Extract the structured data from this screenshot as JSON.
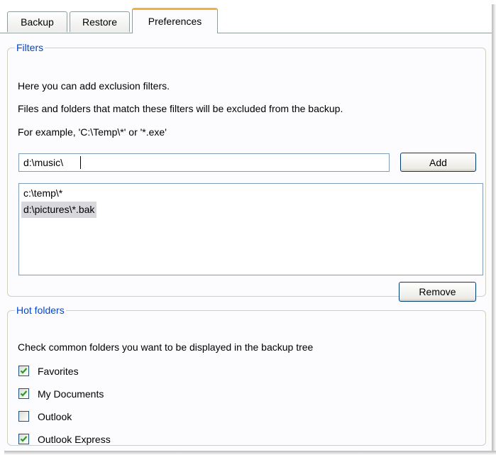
{
  "tabs": [
    {
      "label": "Backup",
      "active": false
    },
    {
      "label": "Restore",
      "active": false
    },
    {
      "label": "Preferences",
      "active": true
    }
  ],
  "filters": {
    "title": "Filters",
    "line1": "Here you can add exclusion filters.",
    "line2": "Files and folders that match these filters will be excluded from the backup.",
    "line3": "For example, 'C:\\Temp\\*' or '*.exe'",
    "input_value": "d:\\music\\",
    "add_label": "Add",
    "items": [
      {
        "text": "c:\\temp\\*",
        "selected": false
      },
      {
        "text": "d:\\pictures\\*.bak",
        "selected": true
      }
    ],
    "remove_label": "Remove"
  },
  "hot_folders": {
    "title": "Hot folders",
    "description": "Check common folders you want to be displayed in the backup tree",
    "items": [
      {
        "label": "Favorites",
        "checked": true
      },
      {
        "label": "My Documents",
        "checked": true
      },
      {
        "label": "Outlook",
        "checked": false
      },
      {
        "label": "Outlook Express",
        "checked": true
      }
    ]
  },
  "colors": {
    "accent_tab": "#f7b036",
    "group_title": "#0046d5",
    "check_mark": "#21a121"
  },
  "icons": {
    "check": "check-mark-icon"
  }
}
